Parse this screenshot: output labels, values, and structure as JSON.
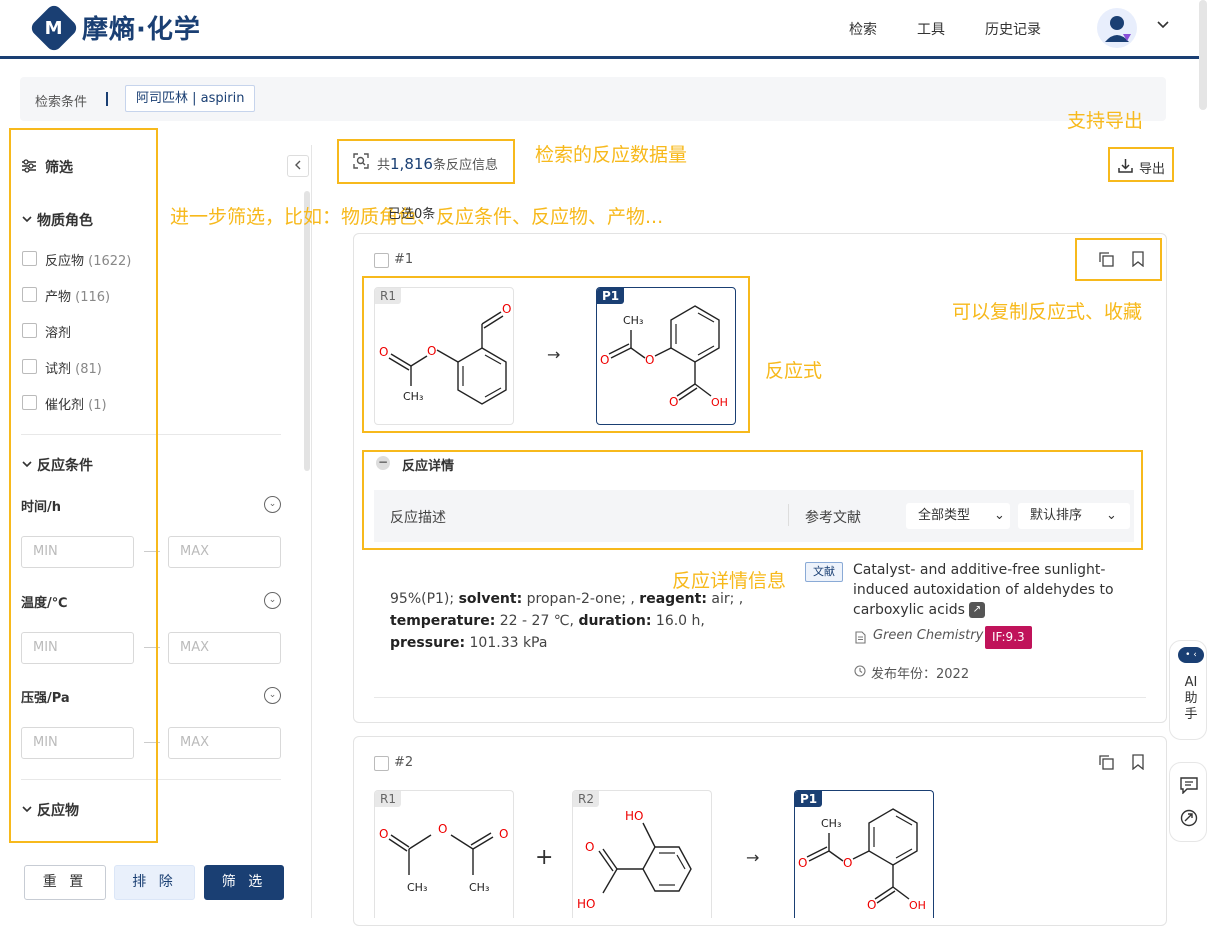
{
  "header": {
    "logo_glyph": "M",
    "logo_text": "摩熵·化学",
    "nav": [
      "检索",
      "工具",
      "历史记录"
    ],
    "avatar_icon": "user-avatar-icon",
    "dropdown_icon": "chevron-down-icon"
  },
  "search_conditions": {
    "label": "检索条件",
    "tag": "阿司匹林 | aspirin"
  },
  "sidebar": {
    "title": "筛选",
    "sections": {
      "role": {
        "title": "物质角色",
        "options": [
          {
            "label": "反应物",
            "count": "(1622)"
          },
          {
            "label": "产物",
            "count": "(116)"
          },
          {
            "label": "溶剂",
            "count": ""
          },
          {
            "label": "试剂",
            "count": "(81)"
          },
          {
            "label": "催化剂",
            "count": "(1)"
          }
        ]
      },
      "conditions": {
        "title": "反应条件",
        "fields": [
          {
            "label": "时间/h",
            "min": "MIN",
            "max": "MAX"
          },
          {
            "label": "温度/℃",
            "min": "MIN",
            "max": "MAX"
          },
          {
            "label": "压强/Pa",
            "min": "MIN",
            "max": "MAX"
          }
        ]
      },
      "reactant": {
        "title": "反应物"
      }
    },
    "buttons": {
      "reset": "重 置",
      "clear": "排 除",
      "filter": "筛 选"
    }
  },
  "results": {
    "total_prefix": "共",
    "total_count": "1,816",
    "total_suffix": "条反应信息",
    "export_label": "导出",
    "partial_label": "已选0条"
  },
  "annotations": {
    "total": "检索的反应数据量",
    "export": "支持导出",
    "filter": "进一步筛选，比如：物质角色、反应条件、反应物、产物...",
    "copy": "可以复制反应式、收藏",
    "equation": "反应式",
    "detail": "反应详情信息"
  },
  "cards": [
    {
      "number": "#1",
      "molecules": [
        "R1",
        "P1"
      ],
      "detail_title": "反应详情",
      "table_headers": {
        "desc": "反应描述",
        "ref": "参考文献"
      },
      "selects": [
        "全部类型",
        "默认排序"
      ],
      "description": {
        "yield": "95%(P1);",
        "solvent_k": "solvent:",
        "solvent_v": "propan-2-one; ,",
        "reagent_k": "reagent:",
        "reagent_v": "air; ,",
        "temp_k": "temperature:",
        "temp_v": "22 - 27 ℃,",
        "dur_k": "duration:",
        "dur_v": "16.0 h,",
        "press_k": "pressure:",
        "press_v": "101.33 kPa"
      },
      "reference": {
        "tag": "文献",
        "title": "Catalyst- and additive-free sunlight-induced autoxidation of aldehydes to carboxylic acids",
        "journal": "Green Chemistry",
        "impact": "IF:9.3",
        "year_label": "发布年份：",
        "year": "2022"
      }
    },
    {
      "number": "#2",
      "molecules": [
        "R1",
        "R2",
        "P1"
      ]
    }
  ],
  "molecule_labels": {
    "o": "O",
    "oh": "OH",
    "ho": "HO",
    "ch3": "CH₃"
  },
  "side_tools": {
    "ai_badge": "• ‹",
    "ai_label": "AI助手"
  }
}
